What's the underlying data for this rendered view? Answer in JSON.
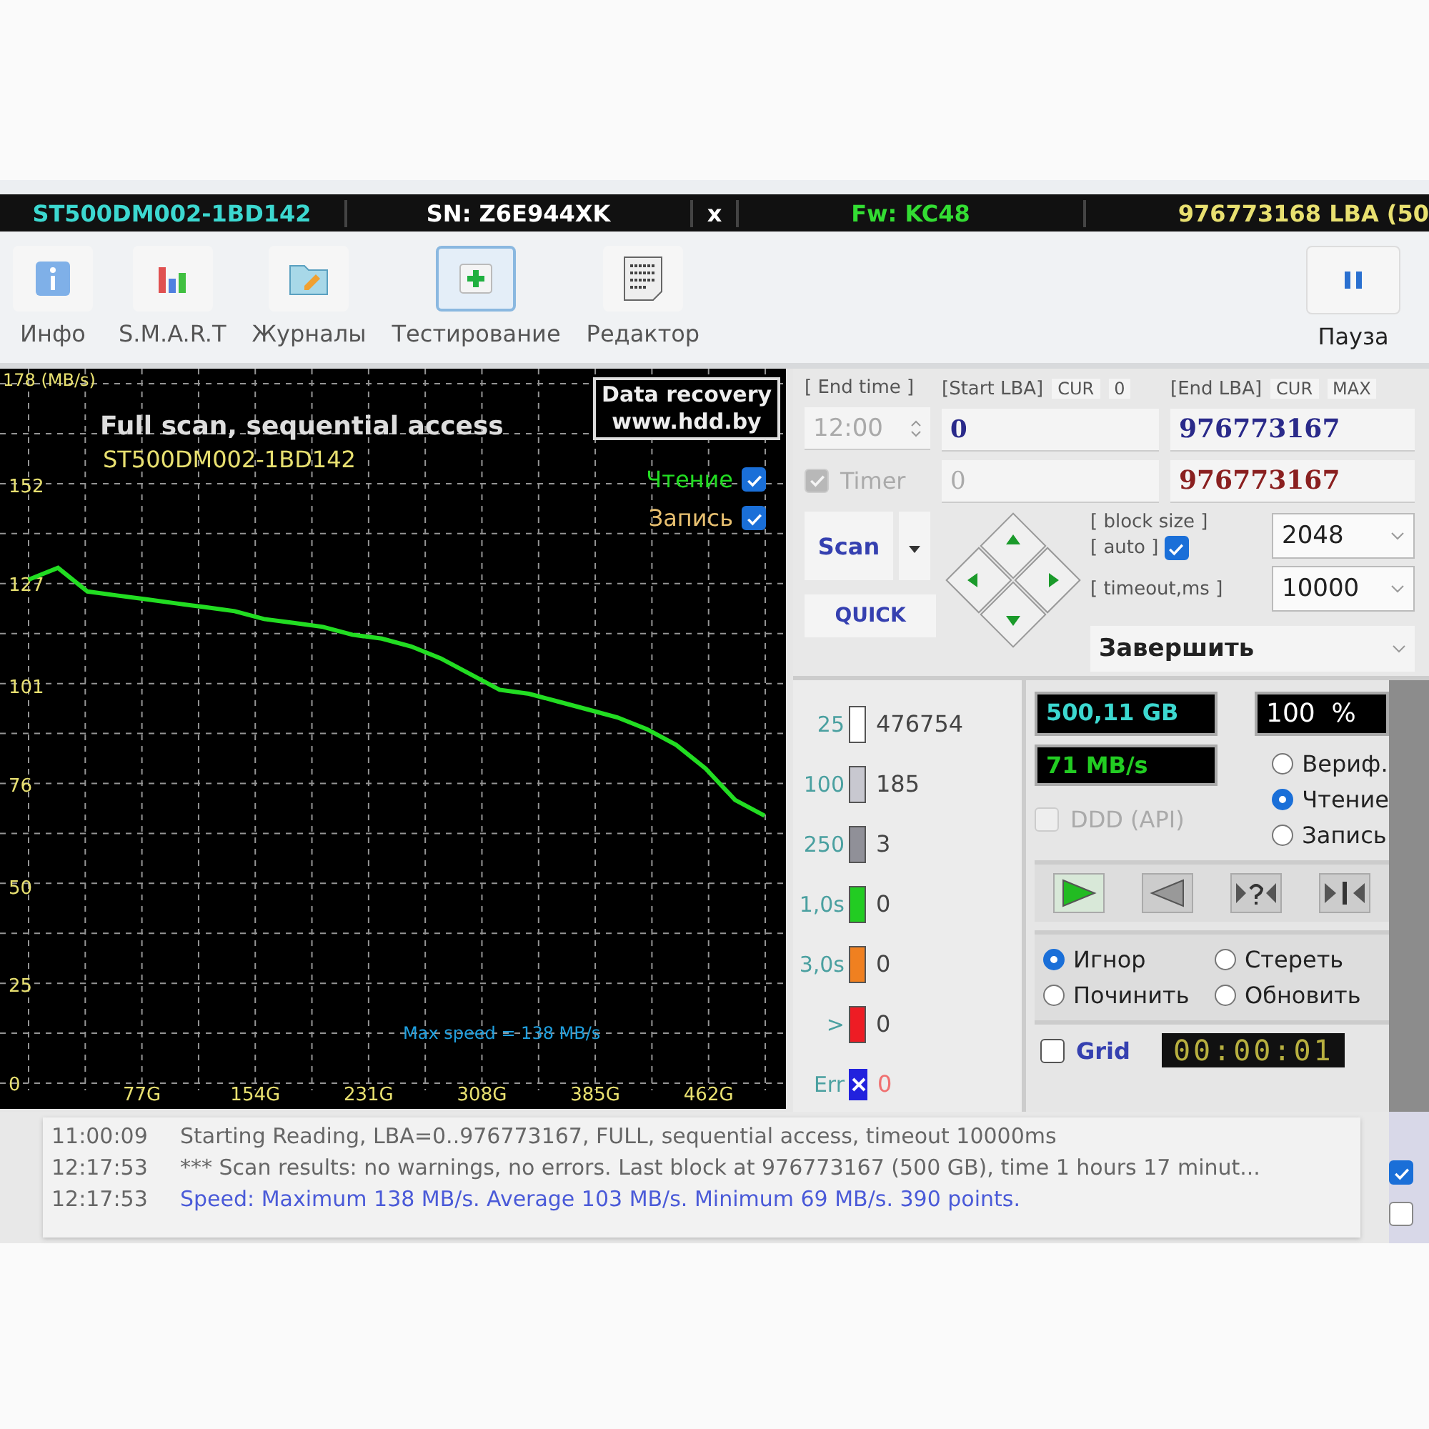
{
  "header": [
    {
      "text": "ST500DM002-1BD142",
      "color": "#3cd8d0"
    },
    {
      "text": "SN: Z6E944XK",
      "color": "#ffffff"
    },
    {
      "text": "x",
      "color": "#ffffff"
    },
    {
      "text": "Fw: KC48",
      "color": "#33dd33"
    },
    {
      "text": "976773168 LBA (50",
      "color": "#e8e070"
    }
  ],
  "toolbar": [
    {
      "kind": "info",
      "label": "Инфо",
      "selected": false
    },
    {
      "kind": "smart",
      "label": "S.M.A.R.T",
      "selected": false
    },
    {
      "kind": "journal",
      "label": "Журналы",
      "selected": false
    },
    {
      "kind": "test",
      "label": "Тестирование",
      "selected": true
    },
    {
      "kind": "editor",
      "label": "Редактор",
      "selected": false
    }
  ],
  "pause_button": {
    "label": "Пауза"
  },
  "chart": {
    "title": "Full scan, sequential access",
    "subtitle": "ST500DM002-1BD142",
    "logo": [
      "Data recovery",
      "www.hdd.by"
    ],
    "legend": [
      {
        "label": "Чтение",
        "checked": true,
        "color": "#22dd22"
      },
      {
        "label": "Запись",
        "checked": true,
        "color": "#e8c070"
      }
    ],
    "max_speed": "Max speed = 138 MB/s",
    "chart_data": {
      "type": "line",
      "ylabel": "178 (MB/s)",
      "x": [
        0,
        20,
        40,
        60,
        80,
        100,
        120,
        140,
        160,
        180,
        200,
        220,
        240,
        260,
        280,
        300,
        320,
        340,
        360,
        380,
        400,
        420,
        440,
        460,
        480,
        500
      ],
      "grid": true,
      "series": [
        {
          "color": "#22dd22",
          "values": [
            128,
            131,
            125,
            124,
            123,
            122,
            121,
            120,
            118,
            117,
            116,
            114,
            113,
            111,
            108,
            104,
            100,
            99,
            97,
            95,
            93,
            90,
            86,
            80,
            72,
            68
          ]
        }
      ],
      "xlim": [
        0,
        500
      ],
      "ylim": [
        0,
        178
      ],
      "xticks": [
        {
          "value": 77,
          "label": "77G"
        },
        {
          "value": 154,
          "label": "154G"
        },
        {
          "value": 231,
          "label": "231G"
        },
        {
          "value": 308,
          "label": "308G"
        },
        {
          "value": 385,
          "label": "385G"
        },
        {
          "value": 462,
          "label": "462G"
        }
      ],
      "yticks": [
        0,
        25,
        50,
        76,
        101,
        127,
        152
      ]
    }
  },
  "controls": {
    "end_time": {
      "label": "[ End time ]",
      "value": "12:00",
      "disabled": true
    },
    "timer": {
      "label": "Timer",
      "checked": true
    },
    "start_lba": {
      "label": "[Start LBA]",
      "cur": "CUR",
      "zero": "0",
      "value": "0",
      "current": "0"
    },
    "end_lba": {
      "label": "[End LBA]",
      "cur": "CUR",
      "max": "MAX",
      "value": "976773167",
      "current": "976773167"
    },
    "scan_button": "Scan",
    "quick_button": "QUICK",
    "block_size": {
      "label": "[ block size ]",
      "value": "2048"
    },
    "auto": {
      "label": "[ auto ]",
      "checked": true
    },
    "timeout": {
      "label": "[ timeout,ms ]",
      "value": "10000"
    },
    "finish": {
      "value": "Завершить"
    }
  },
  "blocks": [
    {
      "label": "25",
      "color": "#ffffff",
      "count": "476754",
      "kind": "box"
    },
    {
      "label": "100",
      "color": "#c8c8d0",
      "count": "185",
      "kind": "box"
    },
    {
      "label": "250",
      "color": "#909098",
      "count": "3",
      "kind": "box"
    },
    {
      "label": "1,0s",
      "color": "#22cc22",
      "count": "0",
      "kind": "box"
    },
    {
      "label": "3,0s",
      "color": "#f08020",
      "count": "0",
      "kind": "box"
    },
    {
      "label": ">",
      "color": "#ee1c24",
      "count": "0",
      "kind": "box"
    },
    {
      "label": "Err",
      "color": "#2222dd",
      "count": "0",
      "kind": "error"
    }
  ],
  "stats": {
    "size": "500,11 GB",
    "percent": "100  %",
    "speed": "71 MB/s"
  },
  "ddd": {
    "label": "DDD (API)",
    "checked": false
  },
  "mode": [
    {
      "label": "Вериф.",
      "selected": false
    },
    {
      "label": "Чтение",
      "selected": true
    },
    {
      "label": "Запись",
      "selected": false
    }
  ],
  "player": [
    {
      "kind": "play",
      "active": true
    },
    {
      "kind": "back",
      "active": false
    },
    {
      "kind": "verify",
      "active": false
    },
    {
      "kind": "end",
      "active": false
    }
  ],
  "repair": [
    {
      "label": "Игнор",
      "selected": true
    },
    {
      "label": "Стереть",
      "selected": false
    },
    {
      "label": "Починить",
      "selected": false
    },
    {
      "label": "Обновить",
      "selected": false
    }
  ],
  "grid": {
    "label": "Grid",
    "checked": false
  },
  "elapsed": "00:00:01",
  "log": [
    {
      "time": "11:00:09",
      "text": "Starting Reading, LBA=0..976773167, FULL, sequential access, timeout 10000ms",
      "kind": "normal"
    },
    {
      "time": "12:17:53",
      "text": "*** Scan results: no warnings, no errors. Last block at 976773167 (500 GB), time 1 hours 17 minut...",
      "kind": "normal"
    },
    {
      "time": "12:17:53",
      "text": "Speed: Maximum 138 MB/s. Average 103 MB/s. Minimum 69 MB/s. 390 points.",
      "kind": "info"
    }
  ],
  "side_checks": [
    {
      "checked": true
    },
    {
      "checked": false
    }
  ]
}
